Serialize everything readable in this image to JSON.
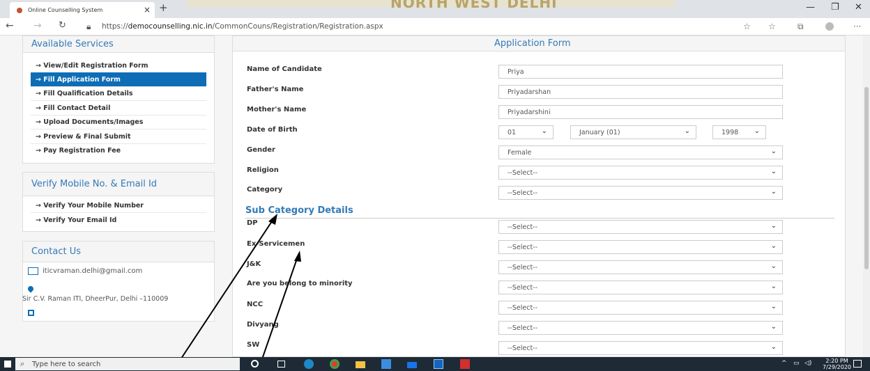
{
  "browser": {
    "tab_title": "Online Counselling System",
    "url_prefix": "https://",
    "url_domain": "democounselling.nic.in",
    "url_path": "/CommonCouns/Registration/Registration.aspx",
    "banner_text": "NORTH WEST DELHI"
  },
  "sidebar": {
    "services_title": "Available Services",
    "services": [
      {
        "label": "→ View/Edit Registration Form",
        "active": false
      },
      {
        "label": "→ Fill Application Form",
        "active": true
      },
      {
        "label": "→ Fill Qualification Details",
        "active": false
      },
      {
        "label": "→ Fill Contact Detail",
        "active": false
      },
      {
        "label": "→ Upload Documents/Images",
        "active": false
      },
      {
        "label": "→ Preview & Final Submit",
        "active": false
      },
      {
        "label": "→ Pay Registration Fee",
        "active": false
      }
    ],
    "verify_title": "Verify Mobile No. & Email Id",
    "verify": [
      {
        "label": "→ Verify Your Mobile Number"
      },
      {
        "label": "→ Verify Your Email Id"
      }
    ],
    "contact_title": "Contact Us",
    "contact_email": "iticvraman.delhi@gmail.com",
    "contact_address": "Sir C.V. Raman ITI, DheerPur, Delhi –110009"
  },
  "form": {
    "title": "Application Form",
    "name_label": "Name of Candidate",
    "name_value": "Priya",
    "father_label": "Father's Name",
    "father_value": "Priyadarshan",
    "mother_label": "Mother's Name",
    "mother_value": "Priyadarshini",
    "dob_label": "Date of Birth",
    "dob_day": "01",
    "dob_month": "January (01)",
    "dob_year": "1998",
    "gender_label": "Gender",
    "gender_value": "Female",
    "religion_label": "Religion",
    "religion_value": "--Select--",
    "category_label": "Category",
    "category_value": "--Select--",
    "sub_title": "Sub Category Details",
    "dp_label": "DP",
    "dp_value": "--Select--",
    "exs_label": "Ex-Servicemen",
    "exs_value": "--Select--",
    "jk_label": "J&K",
    "jk_value": "--Select--",
    "minority_label": "Are you belong to minority",
    "minority_value": "--Select--",
    "ncc_label": "NCC",
    "ncc_value": "--Select--",
    "divyang_label": "Divyang",
    "divyang_value": "--Select--",
    "sw_label": "SW",
    "sw_value": "--Select--"
  },
  "taskbar": {
    "search_placeholder": "Type here to search",
    "time": "2:20 PM",
    "date": "7/29/2020"
  }
}
